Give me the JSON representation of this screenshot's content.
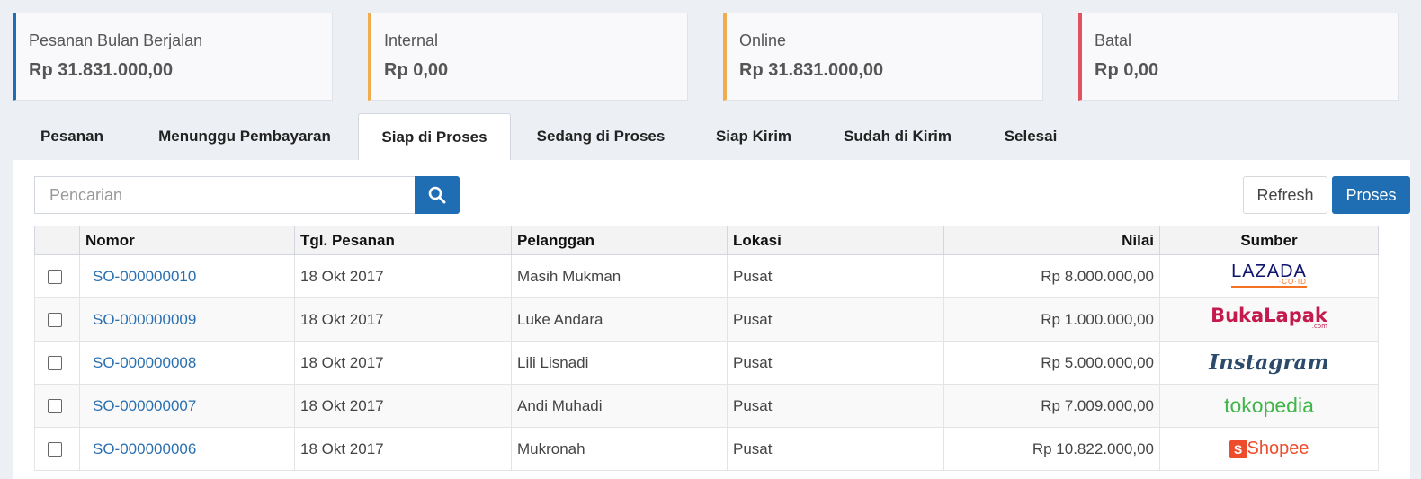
{
  "summary_cards": [
    {
      "label": "Pesanan Bulan Berjalan",
      "value": "Rp 31.831.000,00",
      "color": "#1f6eb4"
    },
    {
      "label": "Internal",
      "value": "Rp 0,00",
      "color": "#f0ad4e"
    },
    {
      "label": "Online",
      "value": "Rp 31.831.000,00",
      "color": "#f0ad4e"
    },
    {
      "label": "Batal",
      "value": "Rp 0,00",
      "color": "#e05260"
    }
  ],
  "tabs": [
    {
      "label": "Pesanan"
    },
    {
      "label": "Menunggu Pembayaran"
    },
    {
      "label": "Siap di Proses",
      "active": true
    },
    {
      "label": "Sedang di Proses"
    },
    {
      "label": "Siap Kirim"
    },
    {
      "label": "Sudah di Kirim"
    },
    {
      "label": "Selesai"
    }
  ],
  "toolbar": {
    "search_placeholder": "Pencarian",
    "search_icon": "search-icon",
    "refresh_label": "Refresh",
    "proses_label": "Proses"
  },
  "table": {
    "headers": [
      "",
      "Nomor",
      "Tgl. Pesanan",
      "Pelanggan",
      "Lokasi",
      "Nilai",
      "Sumber"
    ],
    "rows": [
      {
        "nomor": "SO-000000010",
        "tgl": "18 Okt 2017",
        "pelanggan": "Masih Mukman",
        "lokasi": "Pusat",
        "nilai": "Rp 8.000.000,00",
        "sumber": "LAZADA",
        "sumber_sub": "·CO·ID"
      },
      {
        "nomor": "SO-000000009",
        "tgl": "18 Okt 2017",
        "pelanggan": "Luke Andara",
        "lokasi": "Pusat",
        "nilai": "Rp 1.000.000,00",
        "sumber": "BukaLapak",
        "sumber_sub": ".com"
      },
      {
        "nomor": "SO-000000008",
        "tgl": "18 Okt 2017",
        "pelanggan": "Lili Lisnadi",
        "lokasi": "Pusat",
        "nilai": "Rp 5.000.000,00",
        "sumber": "Instagram"
      },
      {
        "nomor": "SO-000000007",
        "tgl": "18 Okt 2017",
        "pelanggan": "Andi Muhadi",
        "lokasi": "Pusat",
        "nilai": "Rp 7.009.000,00",
        "sumber": "tokopedia"
      },
      {
        "nomor": "SO-000000006",
        "tgl": "18 Okt 2017",
        "pelanggan": "Mukronah",
        "lokasi": "Pusat",
        "nilai": "Rp 10.822.000,00",
        "sumber": "Shopee"
      }
    ]
  }
}
